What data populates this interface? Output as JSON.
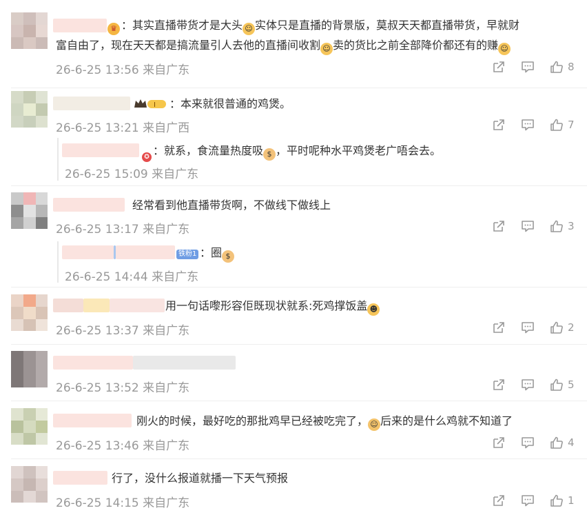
{
  "comments": [
    {
      "text_line1": "：其实直播带货才是大头",
      "text_mid1": "实体只是直播的背景版，莫叔天天都直播带货，早就财",
      "text_line2": "富自由了，现在天天都是搞流量引人去他的直播间收割",
      "text_mid2": "卖的货比之前全部降价都还有的赚",
      "time": "26-6-25 13:56",
      "location": "来自广东",
      "likes": "8"
    },
    {
      "text": "：本来就很普通的鸡煲。",
      "time": "26-6-25 13:21",
      "location": "来自广西",
      "likes": "7",
      "reply": {
        "text_a": "：就系，食流量热度吸",
        "text_b": "，平时呢种水平鸡煲老广唔会去。",
        "time": "26-6-25 15:09",
        "location": "来自广东"
      }
    },
    {
      "text": "经常看到他直播带货啊，不做线下做线上",
      "time": "26-6-25 13:17",
      "location": "来自广东",
      "likes": "3",
      "reply": {
        "badge": "铁粉1",
        "text": "：圈",
        "time": "26-6-25 14:44",
        "location": "来自广东"
      }
    },
    {
      "text": "用一句话嚟形容佢既现状就系:死鸡撑饭盖",
      "time": "26-6-25 13:37",
      "location": "来自广东",
      "likes": "2"
    },
    {
      "time": "26-6-25 13:52",
      "location": "来自广东",
      "likes": "5"
    },
    {
      "text_a": "刚火的时候，最好吃的那批鸡早已经被吃完了，",
      "text_b": "后来的是什么鸡就不知道了",
      "time": "26-6-25 13:46",
      "location": "来自广东",
      "likes": "4"
    },
    {
      "text": "行了，没什么报道就播一下天气预报",
      "time": "26-6-25 14:15",
      "location": "来自广东",
      "likes": "1"
    }
  ],
  "icons": {
    "share": "share-icon",
    "comment": "comment-icon",
    "like": "thumbs-up-icon"
  },
  "colors": {
    "text": "#333333",
    "meta": "#999999",
    "divider": "#eeeeee"
  }
}
